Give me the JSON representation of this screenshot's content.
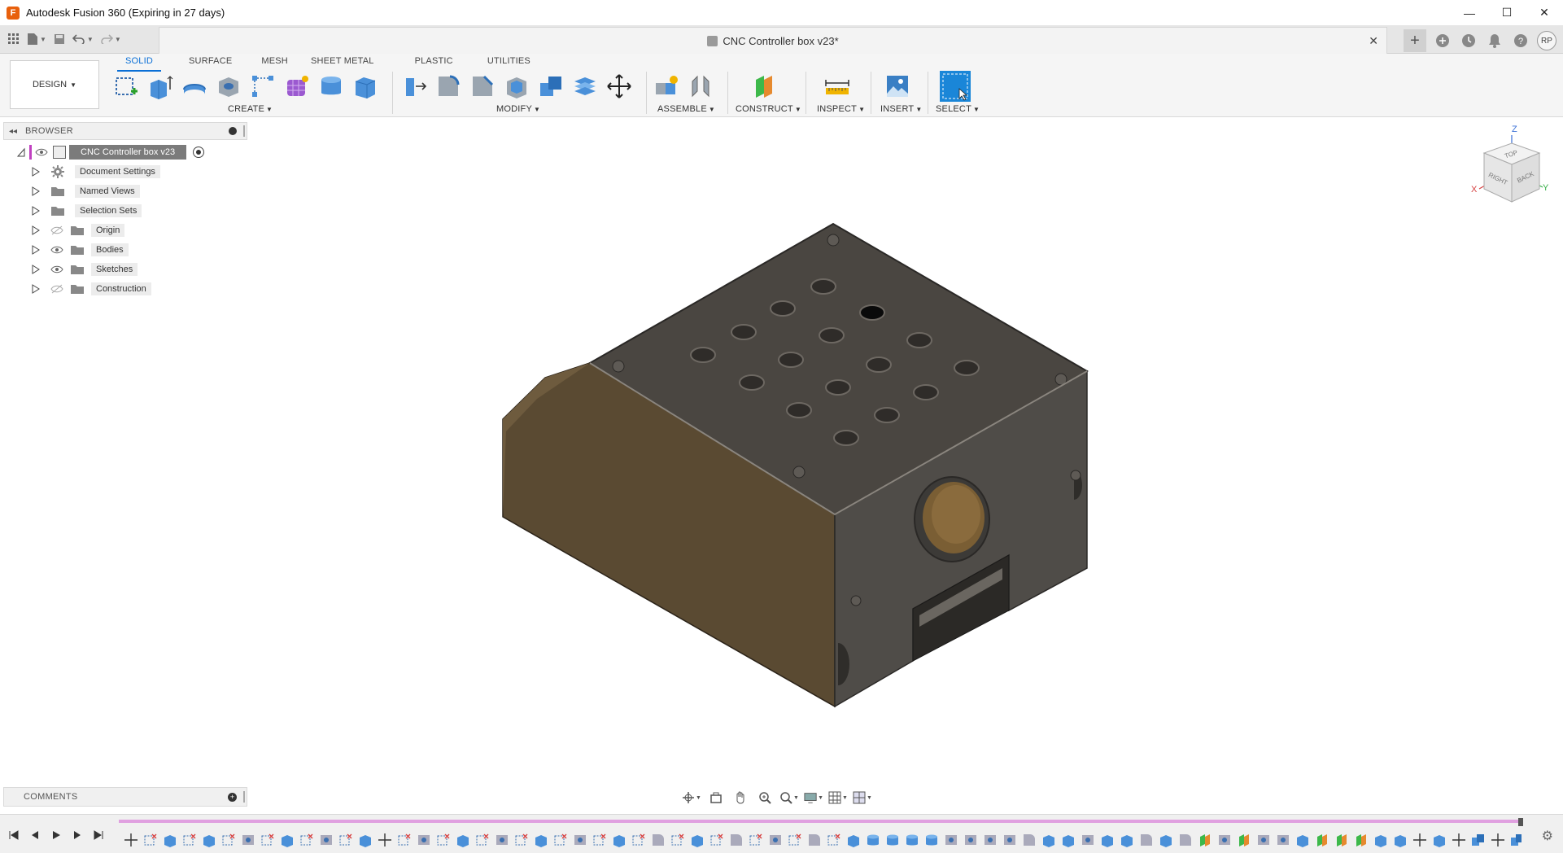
{
  "window": {
    "title": "Autodesk Fusion 360 (Expiring in 27 days)",
    "app_icon": "F",
    "controls": {
      "minimize": "—",
      "maximize": "☐",
      "close": "✕"
    }
  },
  "quick_access": {
    "document_title": "CNC Controller box v23*",
    "close_tab": "✕",
    "user_initials": "RP"
  },
  "ribbon": {
    "workspace": "DESIGN",
    "tabs": [
      "SOLID",
      "SURFACE",
      "MESH",
      "SHEET METAL",
      "PLASTIC",
      "UTILITIES"
    ],
    "active_tab": "SOLID",
    "groups": {
      "create": "CREATE",
      "modify": "MODIFY",
      "assemble": "ASSEMBLE",
      "construct": "CONSTRUCT",
      "inspect": "INSPECT",
      "insert": "INSERT",
      "select": "SELECT"
    }
  },
  "browser": {
    "title": "BROWSER",
    "root": "CNC Controller box v23",
    "nodes": [
      {
        "label": "Document Settings",
        "icon": "gear-icon"
      },
      {
        "label": "Named Views",
        "icon": "folder-icon"
      },
      {
        "label": "Selection Sets",
        "icon": "folder-icon"
      },
      {
        "label": "Origin",
        "icon": "folder-icon",
        "visibility": "hidden"
      },
      {
        "label": "Bodies",
        "icon": "folder-icon",
        "visibility": "visible"
      },
      {
        "label": "Sketches",
        "icon": "folder-icon",
        "visibility": "visible"
      },
      {
        "label": "Construction",
        "icon": "folder-icon",
        "visibility": "hidden"
      }
    ]
  },
  "viewcube": {
    "axis_z": "Z",
    "axis_x": "X",
    "axis_y": "Y",
    "face_top": "TOP",
    "face_right": "RIGHT",
    "face_back": "BACK"
  },
  "comments": {
    "title": "COMMENTS"
  },
  "colors": {
    "accent": "#0a6fd6",
    "body_side": "#5a4a32",
    "body_top": "#4a4641",
    "body_front": "#4f4c48",
    "timeline_track": "#e0a0e0"
  }
}
